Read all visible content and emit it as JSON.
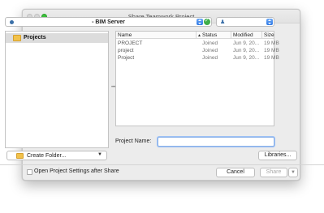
{
  "window": {
    "title": "Share Teamwork Project"
  },
  "server_select": {
    "label": "- BIM Server"
  },
  "folders": {
    "items": [
      {
        "label": "Projects"
      }
    ]
  },
  "create_folder": {
    "label": "Create Folder..."
  },
  "table": {
    "columns": {
      "name": "Name",
      "status": "Status",
      "modified": "Modified",
      "size": "Size"
    },
    "rows": [
      {
        "name": "PROJECT",
        "status": "Joined",
        "modified": "Jun 9, 20...",
        "size": "19 MB"
      },
      {
        "name": "project",
        "status": "Joined",
        "modified": "Jun 9, 20...",
        "size": "19 MB"
      },
      {
        "name": "Project",
        "status": "Joined",
        "modified": "Jun 9, 20...",
        "size": "19 MB"
      }
    ]
  },
  "project_name": {
    "label": "Project Name:",
    "value": ""
  },
  "buttons": {
    "libraries": "Libraries...",
    "cancel": "Cancel",
    "share": "Share"
  },
  "options": {
    "open_settings_label": "Open Project Settings after Share"
  },
  "colors": {
    "accent": "#2f7ae6",
    "focus_ring": "#9cc0f5",
    "folder": "#f2c24b",
    "zoom_button": "#3bc03b"
  }
}
